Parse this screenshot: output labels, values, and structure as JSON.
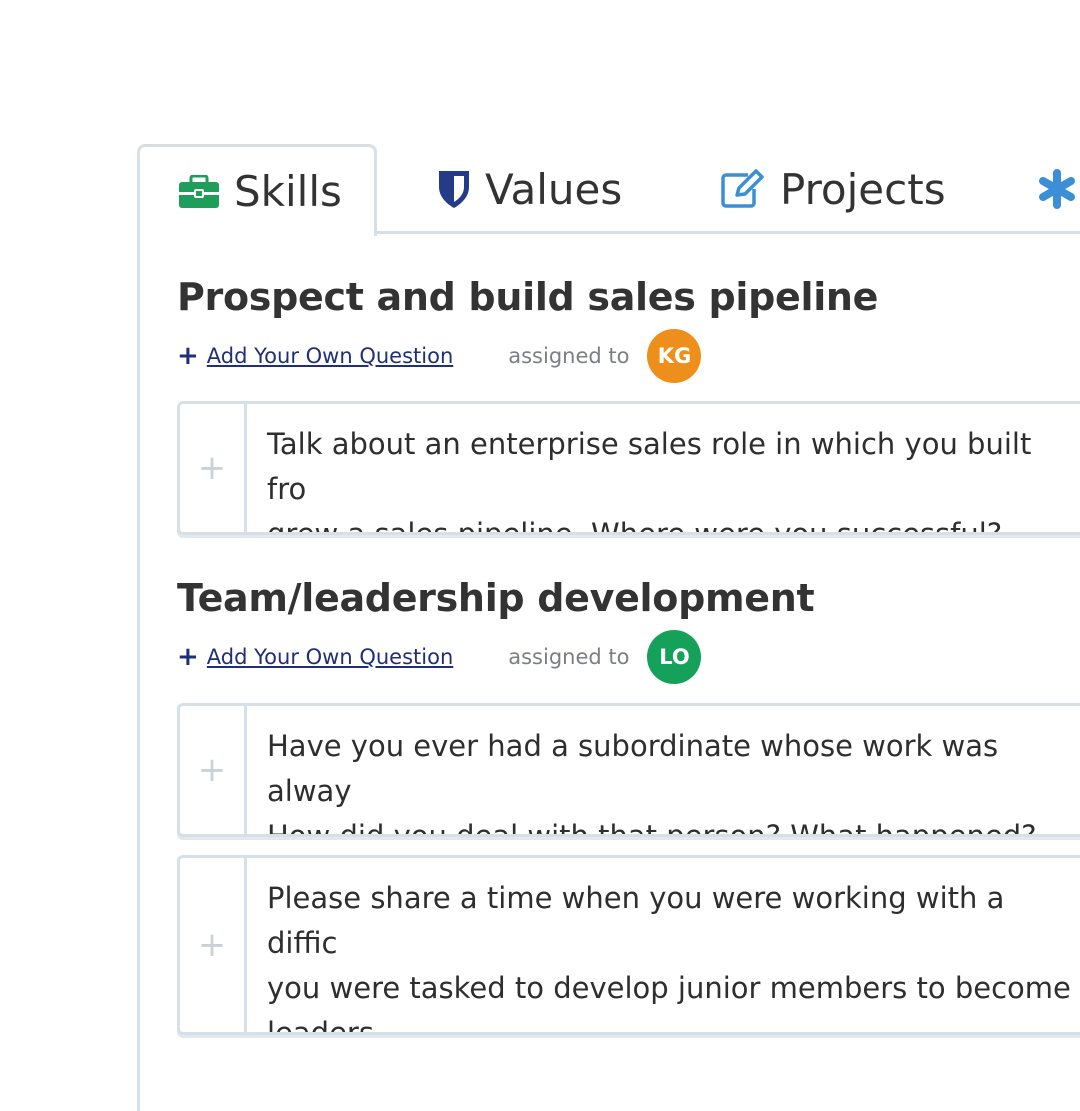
{
  "tabs": [
    {
      "label": "Skills",
      "icon": "briefcase-icon",
      "color": "#1e9e5a",
      "active": true
    },
    {
      "label": "Values",
      "icon": "shield-icon",
      "color": "#243b8a",
      "active": false
    },
    {
      "label": "Projects",
      "icon": "edit-icon",
      "color": "#3a8fd6",
      "active": false
    },
    {
      "label": "",
      "icon": "asterisk-icon",
      "color": "#3a8fd6",
      "active": false
    }
  ],
  "sections": [
    {
      "title": "Prospect and build sales pipeline",
      "add_label": "Add Your Own Question",
      "assigned_label": "assigned to",
      "assignee": {
        "initials": "KG",
        "color": "#ee8f1c"
      },
      "questions": [
        "Talk about an enterprise sales role in which you built fro\ngrew a sales pipeline. Where were you successful? Unsu"
      ]
    },
    {
      "title": "Team/leadership development",
      "add_label": "Add Your Own Question",
      "assigned_label": "assigned to",
      "assignee": {
        "initials": "LO",
        "color": "#15a15a"
      },
      "questions": [
        "Have you ever had a subordinate whose work was alway\nHow did you deal with that person? What happened?",
        "Please share a time when you were working with a diffic\nyou were tasked to develop junior members to become\nleaders."
      ]
    }
  ]
}
